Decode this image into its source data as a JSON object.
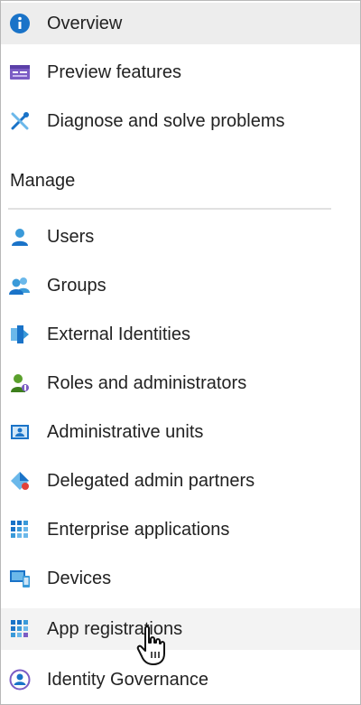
{
  "nav": {
    "top_items": [
      {
        "label": "Overview",
        "icon": "info-icon",
        "selected": true
      },
      {
        "label": "Preview features",
        "icon": "preview-features-icon"
      },
      {
        "label": "Diagnose and solve problems",
        "icon": "diagnose-tools-icon"
      }
    ],
    "section_header": "Manage",
    "manage_items": [
      {
        "label": "Users",
        "icon": "user-icon"
      },
      {
        "label": "Groups",
        "icon": "groups-icon"
      },
      {
        "label": "External Identities",
        "icon": "external-identities-icon"
      },
      {
        "label": "Roles and administrators",
        "icon": "roles-icon"
      },
      {
        "label": "Administrative units",
        "icon": "admin-units-icon"
      },
      {
        "label": "Delegated admin partners",
        "icon": "delegated-partners-icon"
      },
      {
        "label": "Enterprise applications",
        "icon": "enterprise-apps-icon"
      },
      {
        "label": "Devices",
        "icon": "devices-icon"
      },
      {
        "label": "App registrations",
        "icon": "app-registrations-icon",
        "hovered": true
      },
      {
        "label": "Identity Governance",
        "icon": "identity-governance-icon"
      }
    ]
  },
  "colors": {
    "accent_blue": "#1a73c8",
    "light_blue": "#6bb8ea",
    "purple": "#7b5cc4",
    "green": "#5aa02c",
    "selected_bg": "#ededed",
    "hover_bg": "#f3f3f3"
  }
}
